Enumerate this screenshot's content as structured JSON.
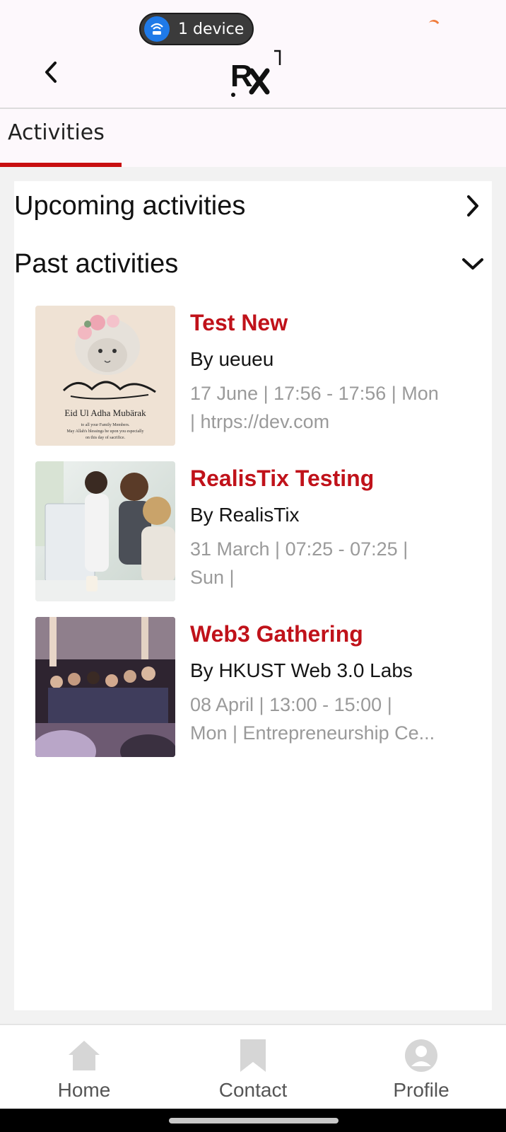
{
  "status": {
    "device_label": "1 device"
  },
  "header": {
    "logo_text": "Rx"
  },
  "tabs": {
    "active_label": "Activities"
  },
  "sections": {
    "upcoming_label": "Upcoming activities",
    "past_label": "Past activities"
  },
  "events": [
    {
      "title": "Test New",
      "organizer": "By ueueu",
      "meta_line1": "17 June  | 17:56 - 17:56 | Mon",
      "meta_line2": "| htrps://dev.com",
      "image_text_title": "Eid Ul Adha Mubärak",
      "image_text_line1": "to all your Family Members.",
      "image_text_line2": "May Allah's blessings be upon you especially",
      "image_text_line3": "on this day of sacrifice."
    },
    {
      "title": "RealisTix Testing",
      "organizer": "By RealisTix",
      "meta_line1": "31 March  | 07:25 - 07:25 |",
      "meta_line2": "Sun |"
    },
    {
      "title": " Web3 Gathering",
      "organizer": "By HKUST Web 3.0 Labs",
      "meta_line1": "08 April  | 13:00 - 15:00 |",
      "meta_line2": "Mon | Entrepreneurship Ce..."
    }
  ],
  "bottom_nav": {
    "home_label": "Home",
    "contact_label": "Contact",
    "profile_label": "Profile"
  },
  "colors": {
    "accent": "#c80f10",
    "title_red": "#c0121a",
    "meta_gray": "#9a9a9a",
    "nav_icon_gray": "#d6d6d6"
  }
}
